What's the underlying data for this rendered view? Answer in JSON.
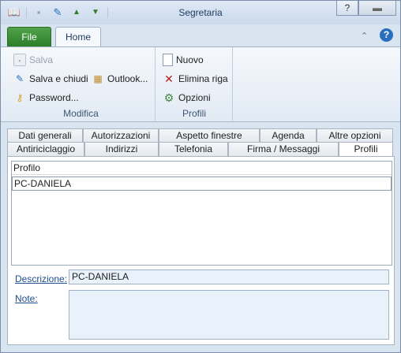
{
  "window": {
    "title": "Segretaria",
    "help_btn": "?",
    "close_btn": ""
  },
  "qat": {
    "app_icon": "book-icon",
    "save_icon": "save-icon",
    "edit_icon": "edit-icon",
    "up": "▲",
    "down": "▼"
  },
  "ribbon_tabs": {
    "file": "File",
    "home": "Home"
  },
  "ribbon": {
    "modifica": {
      "label": "Modifica",
      "salva": "Salva",
      "salva_chiudi": "Salva e chiudi",
      "outlook": "Outlook...",
      "password": "Password..."
    },
    "profili": {
      "label": "Profili",
      "nuovo": "Nuovo",
      "elimina": "Elimina riga",
      "opzioni": "Opzioni"
    }
  },
  "tabs": {
    "row1": [
      "Dati generali",
      "Autorizzazioni",
      "Aspetto finestre",
      "Agenda",
      "Altre opzioni"
    ],
    "row2": [
      "Antiriciclaggio",
      "Indirizzi",
      "Telefonia",
      "Firma / Messaggi",
      "Profili"
    ]
  },
  "grid": {
    "header": "Profilo",
    "rows": [
      "PC-DANIELA"
    ]
  },
  "form": {
    "descrizione_label": "Descrizione:",
    "descrizione_value": "PC-DANIELA",
    "note_label": "Note:",
    "note_value": ""
  }
}
